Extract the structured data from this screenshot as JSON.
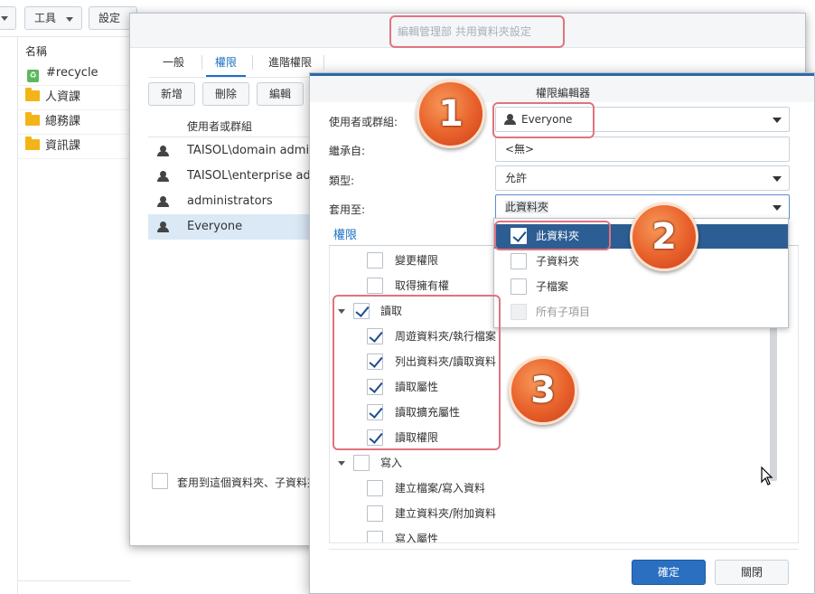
{
  "background": {
    "toolbar_buttons": [
      "工具",
      "設定"
    ],
    "list_header": "名稱",
    "items": [
      "#recycle",
      "人資課",
      "總務課",
      "資訊課"
    ]
  },
  "middle_dialog": {
    "title": "編輯管理部 共用資料夾設定",
    "tabs": [
      "一般",
      "權限",
      "進階權限"
    ],
    "buttons": [
      "新增",
      "刪除",
      "編輯"
    ],
    "column_header": "使用者或群組",
    "rows": [
      "TAISOL\\domain admins",
      "TAISOL\\enterprise admins",
      "administrators",
      "Everyone"
    ],
    "apply_checkbox_label": "套用到這個資料夾、子資料夾"
  },
  "editor": {
    "title": "權限編輯器",
    "labels": {
      "user_or_group": "使用者或群組:",
      "inherited_from": "繼承自:",
      "type": "類型:",
      "apply_to": "套用至:"
    },
    "values": {
      "user_or_group": "Everyone",
      "inherited_from": "<無>",
      "type": "允許",
      "apply_to": "此資料夾"
    },
    "permissions_title": "權限",
    "perm_items": [
      "變更權限",
      "取得擁有權"
    ],
    "read_group": {
      "label": "讀取",
      "children": [
        "周遊資料夾/執行檔案",
        "列出資料夾/讀取資料",
        "讀取屬性",
        "讀取擴充屬性",
        "讀取權限"
      ]
    },
    "write_group": {
      "label": "寫入",
      "children": [
        "建立檔案/寫入資料",
        "建立資料夾/附加資料",
        "寫入屬性"
      ]
    },
    "dropdown_options": [
      {
        "label": "此資料夾",
        "checked": true
      },
      {
        "label": "子資料夾",
        "checked": false
      },
      {
        "label": "子檔案",
        "checked": false
      },
      {
        "label": "所有子項目",
        "checked": false
      }
    ],
    "ok_label": "確定",
    "close_label": "關閉"
  },
  "annotations": [
    "1",
    "2",
    "3"
  ],
  "colors": {
    "accent": "#1d70c4",
    "selected": "#2d5e93",
    "ok_button": "#2a6fc0",
    "annotation": "#e8602a"
  }
}
